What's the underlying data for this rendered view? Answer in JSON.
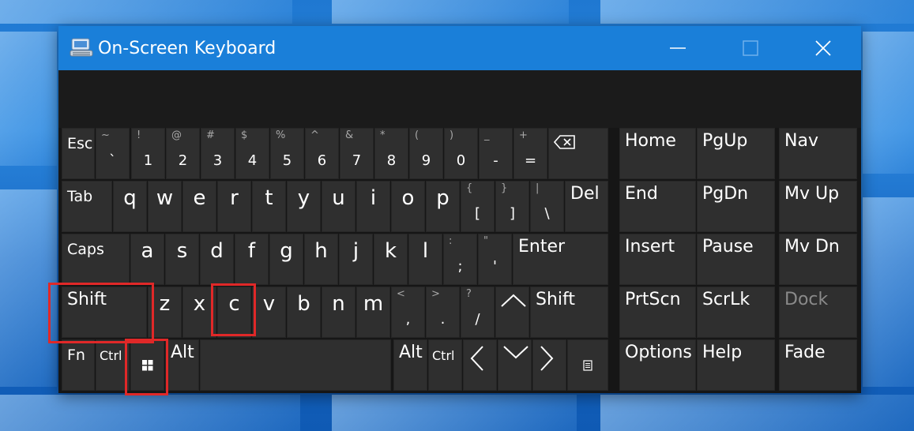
{
  "window": {
    "title": "On-Screen Keyboard",
    "controls": {
      "minimize": "minimize",
      "maximize": "maximize",
      "close": "close"
    }
  },
  "keys": {
    "row1": {
      "esc": "Esc",
      "backtick": {
        "top": "~",
        "bottom": "`"
      },
      "d1": {
        "top": "!",
        "bottom": "1"
      },
      "d2": {
        "top": "@",
        "bottom": "2"
      },
      "d3": {
        "top": "#",
        "bottom": "3"
      },
      "d4": {
        "top": "$",
        "bottom": "4"
      },
      "d5": {
        "top": "%",
        "bottom": "5"
      },
      "d6": {
        "top": "^",
        "bottom": "6"
      },
      "d7": {
        "top": "&",
        "bottom": "7"
      },
      "d8": {
        "top": "*",
        "bottom": "8"
      },
      "d9": {
        "top": "(",
        "bottom": "9"
      },
      "d0": {
        "top": ")",
        "bottom": "0"
      },
      "minus": {
        "top": "_",
        "bottom": "-"
      },
      "equals": {
        "top": "+",
        "bottom": "="
      },
      "home": "Home",
      "pgup": "PgUp",
      "nav": "Nav"
    },
    "row2": {
      "tab": "Tab",
      "q": "q",
      "w": "w",
      "e": "e",
      "r": "r",
      "t": "t",
      "y": "y",
      "u": "u",
      "i": "i",
      "o": "o",
      "p": "p",
      "lbracket": {
        "top": "{",
        "bottom": "["
      },
      "rbracket": {
        "top": "}",
        "bottom": "]"
      },
      "backslash": {
        "top": "|",
        "bottom": "\\"
      },
      "del": "Del",
      "end": "End",
      "pgdn": "PgDn",
      "mvup": "Mv Up"
    },
    "row3": {
      "caps": "Caps",
      "a": "a",
      "s": "s",
      "d": "d",
      "f": "f",
      "g": "g",
      "h": "h",
      "j": "j",
      "k": "k",
      "l": "l",
      "semicolon": {
        "top": ":",
        "bottom": ";"
      },
      "quote": {
        "top": "\"",
        "bottom": "'"
      },
      "enter": "Enter",
      "insert": "Insert",
      "pause": "Pause",
      "mvdn": "Mv Dn"
    },
    "row4": {
      "shift_l": "Shift",
      "z": "z",
      "x": "x",
      "c": "c",
      "v": "v",
      "b": "b",
      "n": "n",
      "m": "m",
      "comma": {
        "top": "<",
        "bottom": ","
      },
      "period": {
        "top": ">",
        "bottom": "."
      },
      "slash": {
        "top": "?",
        "bottom": "/"
      },
      "shift_r": "Shift",
      "prtscn": "PrtScn",
      "scrlk": "ScrLk",
      "dock": "Dock"
    },
    "row5": {
      "fn": "Fn",
      "ctrl_l": "Ctrl",
      "alt_l": "Alt",
      "alt_r": "Alt",
      "ctrl_r": "Ctrl",
      "options": "Options",
      "help": "Help",
      "fade": "Fade"
    }
  },
  "colors": {
    "titlebar": "#1a7fd9",
    "key": "#2f2f2f",
    "highlight": "#e02828"
  }
}
